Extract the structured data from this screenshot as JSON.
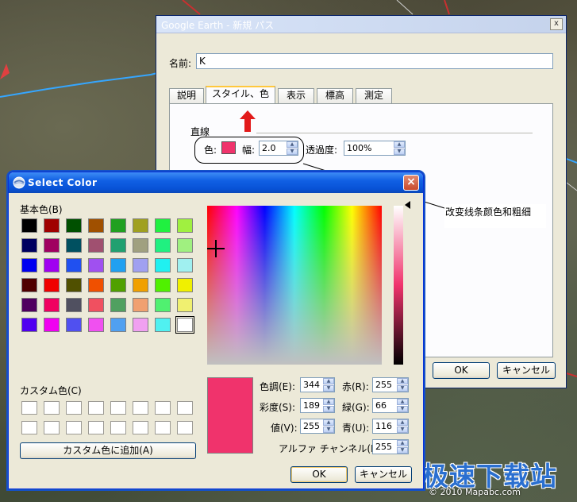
{
  "ge_dialog": {
    "title": "Google Earth - 新規 パス",
    "close_glyph": "x",
    "name_label": "名前:",
    "name_value": "K",
    "tabs": [
      {
        "label": "説明"
      },
      {
        "label": "スタイル、色"
      },
      {
        "label": "表示"
      },
      {
        "label": "標高"
      },
      {
        "label": "測定"
      }
    ],
    "active_tab": "スタイル、色",
    "line_group_label": "直線",
    "color_label": "色:",
    "line_color": "#f0336c",
    "width_label": "幅:",
    "width_value": "2.0",
    "transparency_label": "透過度:",
    "transparency_value": "100%",
    "ok_label": "OK",
    "cancel_label": "キャンセル"
  },
  "annotation": {
    "callout_text": "改变线条颜色和粗细"
  },
  "select_color": {
    "title": "Select Color",
    "close_glyph": "×",
    "basic_colors_label": "基本色(B)",
    "basic_colors": [
      [
        "#000000",
        "#a00000",
        "#005000",
        "#a05000",
        "#20a020",
        "#a0a020",
        "#20f040",
        "#a0f040"
      ],
      [
        "#000060",
        "#a00060",
        "#005060",
        "#a05070",
        "#20a070",
        "#a0a080",
        "#20f080",
        "#a0f080"
      ],
      [
        "#0000f0",
        "#a000f0",
        "#2050f0",
        "#a050f0",
        "#20a0f0",
        "#a0a0f0",
        "#20f0f0",
        "#a0f0f0"
      ],
      [
        "#500000",
        "#f00000",
        "#505000",
        "#f05000",
        "#50a000",
        "#f0a000",
        "#50f000",
        "#f0f000"
      ],
      [
        "#500060",
        "#f00060",
        "#505060",
        "#f05060",
        "#50a060",
        "#f0a070",
        "#50f070",
        "#f0f070"
      ],
      [
        "#5000f0",
        "#f000f0",
        "#5050f0",
        "#f050f0",
        "#50a0f0",
        "#f0a0f0",
        "#50f0f0",
        "#ffffff"
      ]
    ],
    "custom_colors_label": "カスタム色(C)",
    "add_custom_label": "カスタム色に追加(A)",
    "selected_color": "#f0336c",
    "fields": {
      "hue_label": "色調(E):",
      "hue": "344",
      "sat_label": "彩度(S):",
      "sat": "189",
      "val_label": "値(V):",
      "val": "255",
      "red_label": "赤(R):",
      "red": "255",
      "green_label": "緑(G):",
      "green": "66",
      "blue_label": "青(U):",
      "blue": "116",
      "alpha_label": "アルファ チャンネル(L):",
      "alpha": "255"
    },
    "ok_label": "OK",
    "cancel_label": "キャンセル"
  },
  "map": {
    "copyright": "© 2010 Mapabc.com",
    "watermark": "极速下载站"
  }
}
